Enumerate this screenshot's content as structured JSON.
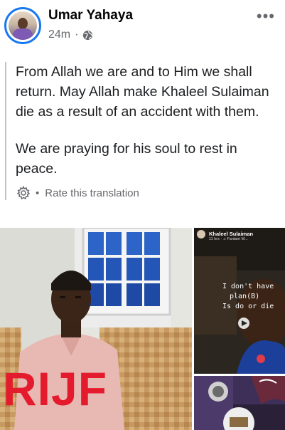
{
  "post": {
    "author": "Umar Yahaya",
    "time": "24m",
    "separator": "·",
    "privacy_icon": "globe-icon",
    "more_icon": "more-options-icon",
    "more_label": "•••"
  },
  "text": {
    "paragraph1": "From Allah we are and to Him we shall return. May Allah make Khaleel Sulaiman die as a result of an accident with them.",
    "paragraph2": "We are praying for his soul to rest in peace.",
    "translation_icon": "gear-icon",
    "translation_dot": "•",
    "translation_label": "Rate this translation"
  },
  "photos": {
    "main_overlay_text": "RIJF",
    "story_user": "Khaleel Sulaiman",
    "story_meta": "11 hrs · ♫ Fantam M...",
    "story_line1": "I don't have",
    "story_line2": "plan(B)",
    "story_line3": "Is do or die"
  },
  "colors": {
    "accent": "#1877f2",
    "secondary_text": "#65676b",
    "overlay_red": "#e31b2c"
  }
}
